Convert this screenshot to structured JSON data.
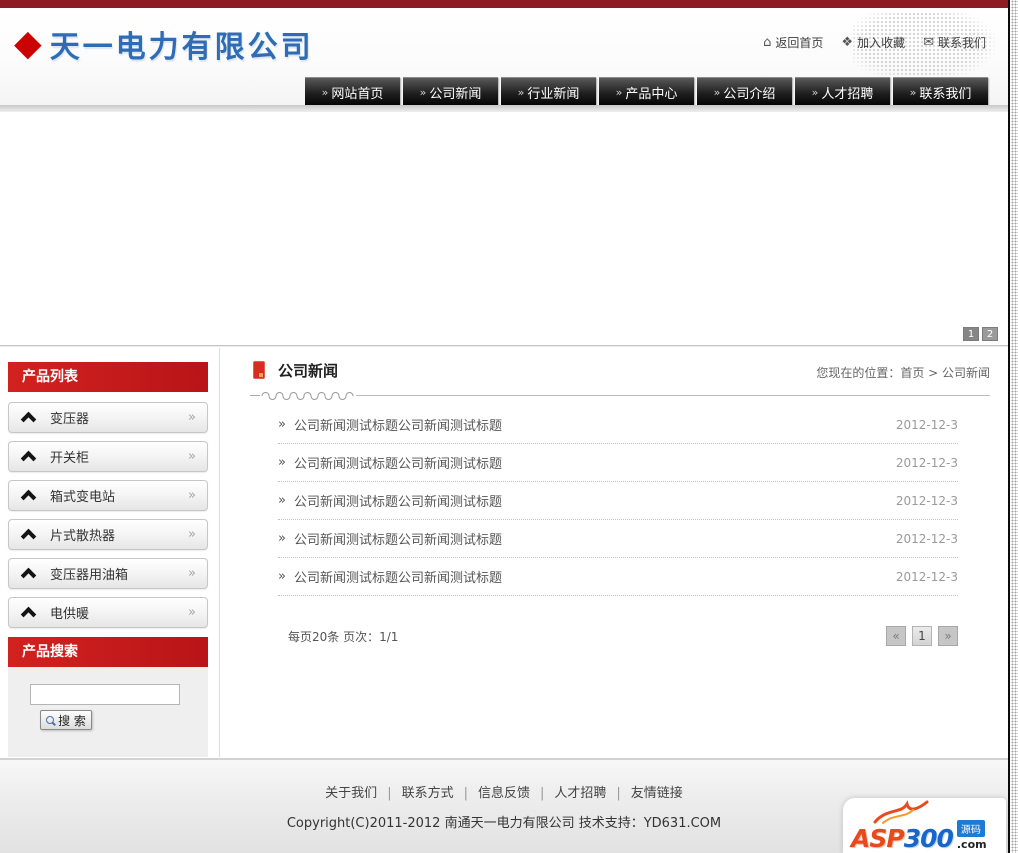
{
  "header": {
    "logo_mark": "◆",
    "company_name": "天一电力有限公司",
    "top_links": [
      "返回首页",
      "加入收藏",
      "联系我们"
    ]
  },
  "icons": {
    "home": "⌂",
    "favorite": "❖",
    "mail": "✉"
  },
  "nav": {
    "arrow": "»",
    "items": [
      "网站首页",
      "公司新闻",
      "行业新闻",
      "产品中心",
      "公司介绍",
      "人才招聘",
      "联系我们"
    ]
  },
  "banner": {
    "pager": [
      "1",
      "2"
    ]
  },
  "sidebar": {
    "list_title": "产品列表",
    "items": [
      "变压器",
      "开关柜",
      "箱式变电站",
      "片式散热器",
      "变压器用油箱",
      "电供暖"
    ],
    "item_arrow": "»",
    "search_title": "产品搜索",
    "search_value": "",
    "search_button": "搜 索"
  },
  "main": {
    "section_title": "公司新闻",
    "breadcrumb": "您现在的位置：首页 > 公司新闻",
    "news_arrow": "»",
    "news": [
      {
        "title": "公司新闻测试标题公司新闻测试标题",
        "date": "2012-12-3"
      },
      {
        "title": "公司新闻测试标题公司新闻测试标题",
        "date": "2012-12-3"
      },
      {
        "title": "公司新闻测试标题公司新闻测试标题",
        "date": "2012-12-3"
      },
      {
        "title": "公司新闻测试标题公司新闻测试标题",
        "date": "2012-12-3"
      },
      {
        "title": "公司新闻测试标题公司新闻测试标题",
        "date": "2012-12-3"
      }
    ],
    "page_info": "每页20条 页次：1/1",
    "pager": {
      "prev": "«",
      "current": "1",
      "next": "»"
    }
  },
  "footer": {
    "links": [
      "关于我们",
      "联系方式",
      "信息反馈",
      "人才招聘",
      "友情链接"
    ],
    "separator": "|",
    "copyright": "Copyright(C)2011-2012 南通天一电力有限公司 技术支持：YD631.COM"
  },
  "watermark": {
    "asp": "ASP",
    "num": "300",
    "yuanma": "源码",
    "com": ".com"
  },
  "colors": {
    "top_bar_red": "#8e1b22",
    "accent_red": "#c81a1e",
    "logo_blue": "#2e6cb5",
    "nav_black": "#000000",
    "muted_text": "#9a9a9a"
  }
}
